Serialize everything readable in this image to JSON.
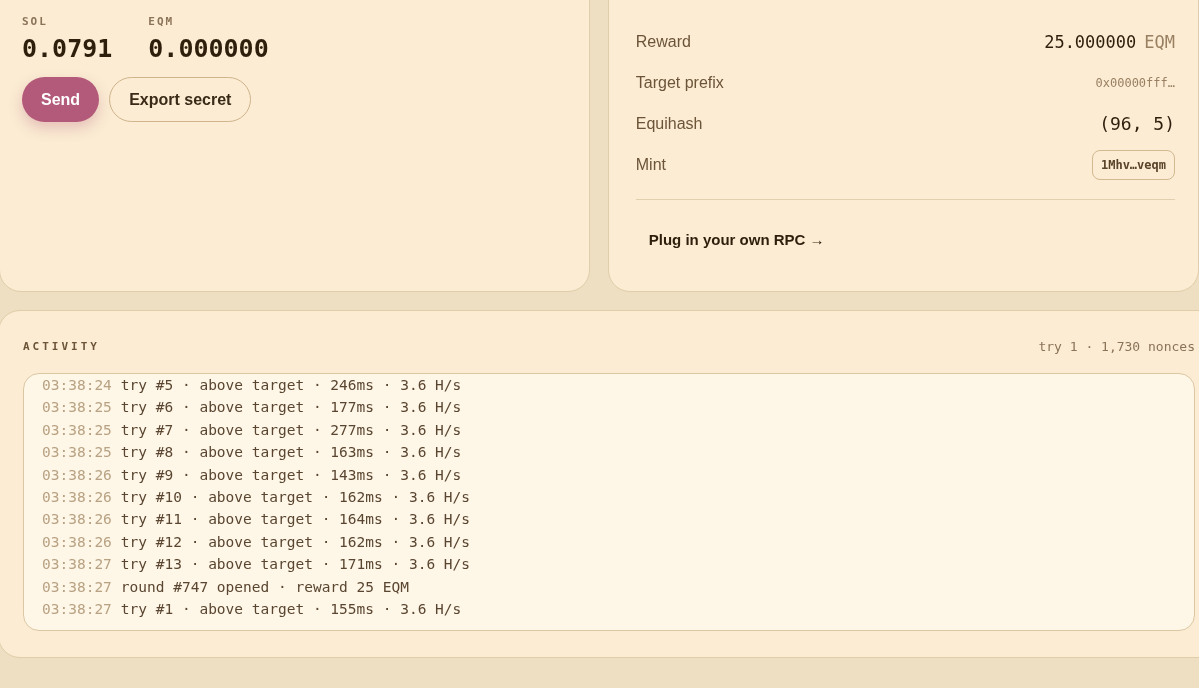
{
  "balances": [
    {
      "label": "SOL",
      "value": "0.0791"
    },
    {
      "label": "EQM",
      "value": "0.000000"
    }
  ],
  "buttons": [
    {
      "label": "Send",
      "kind": "primary"
    },
    {
      "label": "Export secret",
      "kind": "outline"
    }
  ],
  "round_info": [
    {
      "label": "Reward",
      "value": "25.000000",
      "unit": "EQM",
      "kind": "amount"
    },
    {
      "label": "Target prefix",
      "value": "0x00000fff…",
      "kind": "hash"
    },
    {
      "label": "Equihash",
      "value": "(96, 5)",
      "kind": "plain"
    },
    {
      "label": "Mint",
      "value": "1Mhv…veqm",
      "kind": "chip"
    }
  ],
  "rpc_link": "Plug in your own RPC →",
  "activity": {
    "title": "ACTIVITY",
    "summary": "try 1 · 1,730 nonces",
    "log": [
      {
        "time": "03:38:24",
        "text": "try #5 · above target · 246ms · 3.6 H/s"
      },
      {
        "time": "03:38:25",
        "text": "try #6 · above target · 177ms · 3.6 H/s"
      },
      {
        "time": "03:38:25",
        "text": "try #7 · above target · 277ms · 3.6 H/s"
      },
      {
        "time": "03:38:25",
        "text": "try #8 · above target · 163ms · 3.6 H/s"
      },
      {
        "time": "03:38:26",
        "text": "try #9 · above target · 143ms · 3.6 H/s"
      },
      {
        "time": "03:38:26",
        "text": "try #10 · above target · 162ms · 3.6 H/s"
      },
      {
        "time": "03:38:26",
        "text": "try #11 · above target · 164ms · 3.6 H/s"
      },
      {
        "time": "03:38:26",
        "text": "try #12 · above target · 162ms · 3.6 H/s"
      },
      {
        "time": "03:38:27",
        "text": "try #13 · above target · 171ms · 3.6 H/s"
      },
      {
        "time": "03:38:27",
        "text": "round #747 opened · reward 25 EQM"
      },
      {
        "time": "03:38:27",
        "text": "try #1 · above target · 155ms · 3.6 H/s"
      }
    ]
  }
}
